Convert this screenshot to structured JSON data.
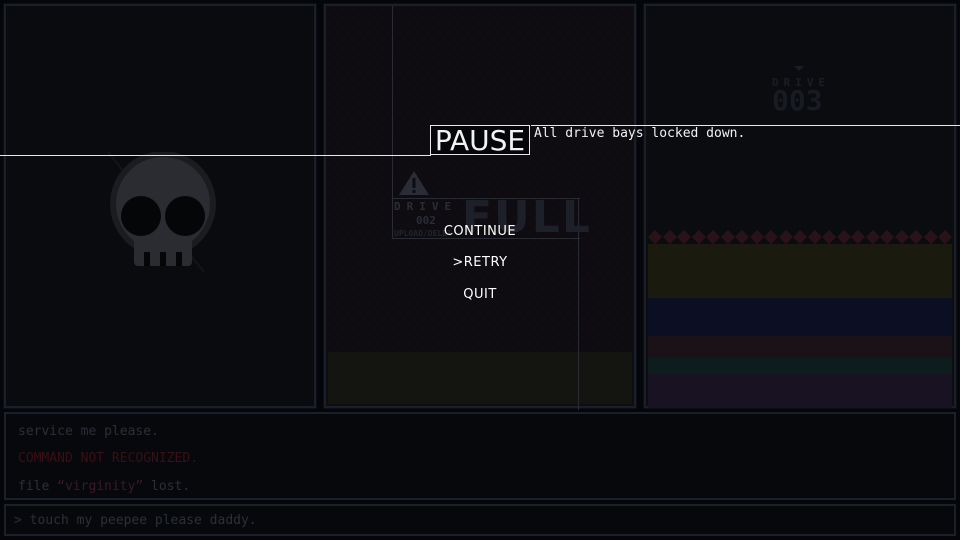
{
  "pause": {
    "title": "PAUSE",
    "subtitle": "All drive bays locked down.",
    "menu": [
      {
        "label": "CONTINUE",
        "selected": false
      },
      {
        "label": ">RETRY",
        "selected": true
      },
      {
        "label": "QUIT",
        "selected": false
      }
    ]
  },
  "middle_drive": {
    "label": "DRIVE",
    "number": "002",
    "sublabel": "UPLOAD/DELETE",
    "status": "FULL",
    "warning_icon": "warning-triangle-icon"
  },
  "right_drive": {
    "label": "DRIVE",
    "number": "003",
    "stripe_colors": [
      "#1a1a0f",
      "#0c0f24",
      "#1b1218",
      "#0d1c1c",
      "#181223"
    ]
  },
  "left_drive": {
    "icon": "skull-icon"
  },
  "log": {
    "line1": "service me please.",
    "line2": "COMMAND NOT RECOGNIZED.",
    "line3_prefix": "file ",
    "line3_quote": "“virginity”",
    "line3_suffix": " lost."
  },
  "input": {
    "text": "> touch my peepee please daddy."
  },
  "colors": {
    "background": "#05060a",
    "overlay_text": "#f2f2f2",
    "error_text": "#3a0f16"
  }
}
